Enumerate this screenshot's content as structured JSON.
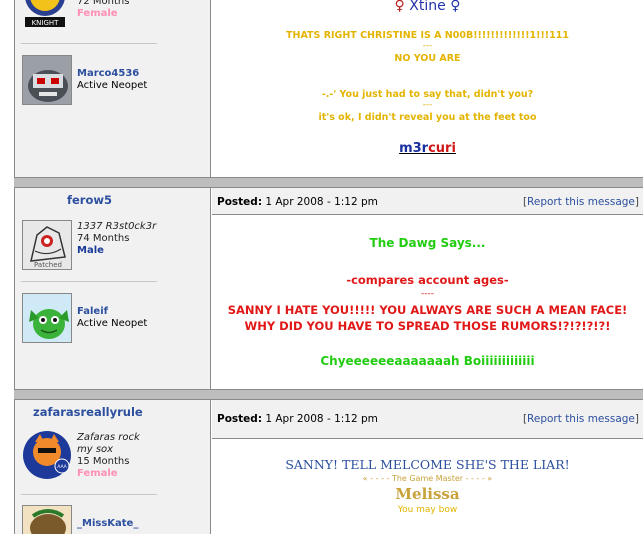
{
  "post1": {
    "author_info_top": "72 Months",
    "author_gender": "Female",
    "avatar_label": "KNIGHT",
    "pet_name": "Marco4536",
    "pet_status": "Active Neopet",
    "sig_name": "Xtine",
    "msg_line1": "THATS RIGHT CHRISTINE IS A N00B!!!!!!!!!!!!!1!!!111",
    "msg_dashes1": "---",
    "msg_line2": "NO YOU ARE",
    "msg_line3": "-.-' You just had to say that, didn't you?",
    "msg_dashes2": "---",
    "msg_line4": "it's ok, I didn't reveal you at the feet too",
    "sig_tag_a": "m3r",
    "sig_tag_b": "curi"
  },
  "post2": {
    "username": "ferow5",
    "title": "1337 R3st0ck3r",
    "months": "74 Months",
    "gender": "Male",
    "avatar_label": "Patched",
    "pet_name": "Faleif",
    "pet_status": "Active Neopet",
    "posted_label": "Posted:",
    "posted_date": "1 Apr 2008 - 1:12 pm",
    "report_open": "[",
    "report_text": "Report this message",
    "report_close": "]",
    "line1": "The Dawg Says...",
    "line2": "-compares account ages-",
    "dashes": "----",
    "line3": "SANNY I HATE YOU!!!!! YOU ALWAYS ARE SUCH A MEAN FACE!",
    "line4": "WHY DID YOU HAVE TO SPREAD THOSE RUMORS!?!?!?!?!",
    "line5": "Chyeeeeeeaaaaaaah Boiiiiiiiiiiiii"
  },
  "post3": {
    "username": "zafarasreallyrule",
    "title_a": "Zafaras rock",
    "title_b": "my sox",
    "months": "15 Months",
    "gender": "Female",
    "avatar_label": "AAA",
    "pet_name": "_MissKate_",
    "posted_label": "Posted:",
    "posted_date": "1 Apr 2008 - 1:12 pm",
    "report_open": "[",
    "report_text": "Report this message",
    "report_close": "]",
    "line1": "SANNY! TELL MELCOME SHE'S THE LIAR!",
    "line2": "« - - - - The Game Master - - - - »",
    "line3": "Melissa",
    "line4": "You may bow"
  },
  "colors": {
    "yellow_text": "#e3b400",
    "green_text": "#22cc11",
    "red_text": "#e01818",
    "blue_link": "#2c4f9e",
    "separator": "#bdbdbd"
  }
}
